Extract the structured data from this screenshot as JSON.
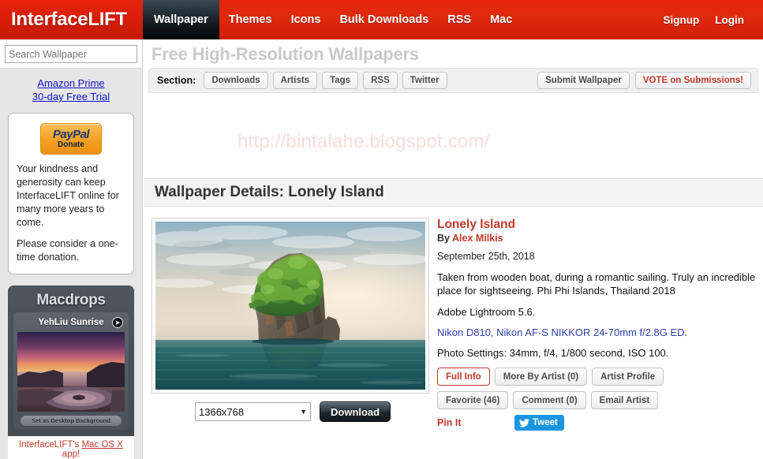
{
  "site": {
    "brand": "InterfaceLIFT",
    "nav": [
      {
        "label": "Wallpaper",
        "active": true
      },
      {
        "label": "Themes",
        "active": false
      },
      {
        "label": "Icons",
        "active": false
      },
      {
        "label": "Bulk Downloads",
        "active": false
      },
      {
        "label": "RSS",
        "active": false
      },
      {
        "label": "Mac",
        "active": false
      }
    ],
    "account": [
      {
        "label": "Signup"
      },
      {
        "label": "Login"
      }
    ]
  },
  "sidebar": {
    "search": {
      "placeholder": "Search Wallpaper",
      "value": ""
    },
    "amazon": {
      "line1": "Amazon Prime",
      "line2": "30-day Free Trial"
    },
    "donate_panel": {
      "paypal_top": "PayPal",
      "paypal_bottom": "Donate",
      "paragraph1": "Your kindness and generosity can keep InterfaceLIFT online for many more years to come.",
      "paragraph2": "Please consider a one-time donation."
    },
    "macdrops": {
      "title": "Macdrops",
      "item_label": "YehLiu Sunrise",
      "set_background_label": "Set as Desktop Background",
      "footer_prefix": "InterfaceLIFT's ",
      "footer_link": "Mac OS X",
      "footer_suffix": " app!"
    }
  },
  "main": {
    "page_title": "Free High-Resolution Wallpapers",
    "section_label": "Section:",
    "section_buttons": [
      "Downloads",
      "Artists",
      "Tags",
      "RSS",
      "Twitter"
    ],
    "section_right_buttons": [
      {
        "label": "Submit Wallpaper",
        "style": "default"
      },
      {
        "label": "VOTE on Submissions!",
        "style": "vote"
      }
    ],
    "watermark": "http://bintalahe.blogspot.com/",
    "details_header": "Wallpaper Details: Lonely Island"
  },
  "wallpaper": {
    "title": "Lonely Island",
    "by_prefix": "By ",
    "author": "Alex Milkis",
    "date": "September 25th, 2018",
    "description": "Taken from wooden boat, during a romantic sailing. Truly an incredible place for sightseeing. Phi Phi Islands, Thailand 2018",
    "software": "Adobe Lightroom 5.6.",
    "gear": "Nikon D810, Nikon AF-S NIKKOR 24-70mm f/2.8G ED.",
    "photo_settings": "Photo Settings: 34mm, f/4, 1/800 second, ISO 100.",
    "action_buttons_row1": [
      {
        "label": "Full Info",
        "style": "fullinfo"
      },
      {
        "label": "More By Artist (0)",
        "style": "default"
      },
      {
        "label": "Artist Profile",
        "style": "default"
      }
    ],
    "action_buttons_row2": [
      {
        "label": "Favorite (46)",
        "style": "default"
      },
      {
        "label": "Comment (0)",
        "style": "default"
      },
      {
        "label": "Email Artist",
        "style": "default"
      }
    ],
    "pin_it_label": "Pin It",
    "tweet_label": "Tweet",
    "resolution_selected": "1366x768",
    "download_label": "Download"
  },
  "colors": {
    "brand_red": "#e0210c",
    "accent_red": "#c0392b",
    "link_blue": "#2b3ea8",
    "twitter_blue": "#1b95e0",
    "watermark_pink": "#f9dcdc"
  }
}
